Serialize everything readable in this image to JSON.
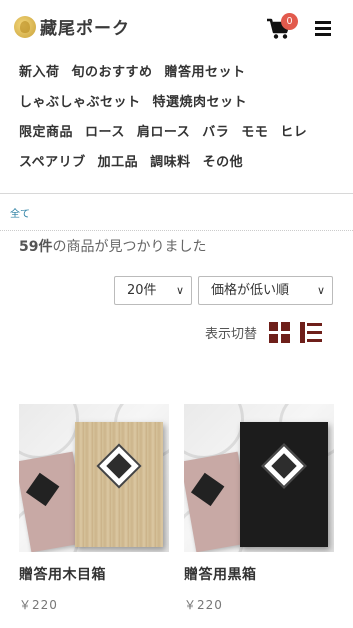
{
  "header": {
    "logo_text": "藏尾ポーク",
    "cart_count": "0"
  },
  "nav": {
    "rows": [
      [
        "新入荷",
        "旬のおすすめ",
        "贈答用セット"
      ],
      [
        "しゃぶしゃぶセット",
        "特選焼肉セット"
      ],
      [
        "限定商品",
        "ロース",
        "肩ロース",
        "バラ",
        "モモ",
        "ヒレ"
      ],
      [
        "スペアリブ",
        "加工品",
        "調味料",
        "その他"
      ]
    ]
  },
  "breadcrumb": {
    "all": "全て"
  },
  "results": {
    "count": "59件",
    "suffix": "の商品が見つかりました"
  },
  "controls": {
    "per_page": "20件",
    "sort": "価格が低い順",
    "view_label": "表示切替"
  },
  "products": [
    {
      "name": "贈答用木目箱",
      "price": "￥220"
    },
    {
      "name": "贈答用黒箱",
      "price": "￥220"
    }
  ],
  "colors": {
    "accent": "#6e1f1a",
    "badge": "#e25a4d",
    "link": "#2a7fa3"
  }
}
